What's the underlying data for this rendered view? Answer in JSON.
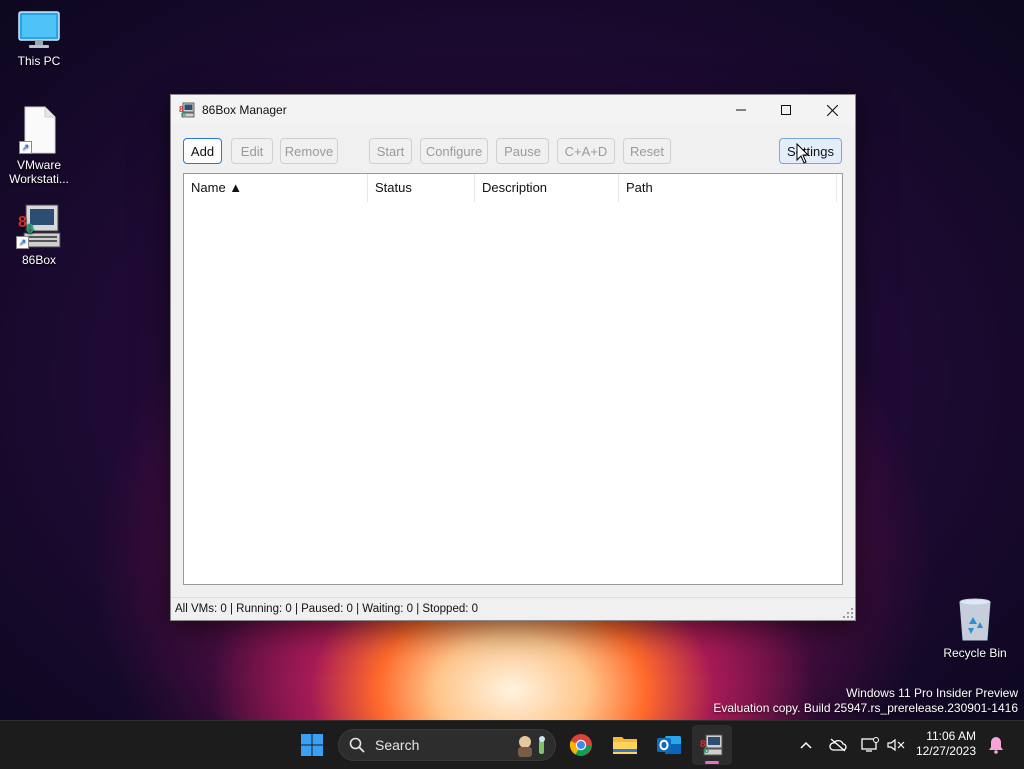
{
  "desktop": {
    "icons": [
      {
        "label": "This PC"
      },
      {
        "label": "VMware Workstati..."
      },
      {
        "label": "86Box"
      },
      {
        "label": "Recycle Bin"
      }
    ]
  },
  "window": {
    "title": "86Box Manager",
    "toolbar": {
      "add": "Add",
      "edit": "Edit",
      "remove": "Remove",
      "start": "Start",
      "configure": "Configure",
      "pause": "Pause",
      "cad": "C+A+D",
      "reset": "Reset",
      "settings": "Settings"
    },
    "columns": [
      "Name ▲",
      "Status",
      "Description",
      "Path"
    ],
    "rows": [],
    "status": "All VMs: 0 | Running: 0 | Paused: 0 | Waiting: 0 | Stopped: 0"
  },
  "watermark": {
    "line1": "Windows 11 Pro Insider Preview",
    "line2": "Evaluation copy. Build 25947.rs_prerelease.230901-1416"
  },
  "taskbar": {
    "search_placeholder": "Search",
    "time": "11:06 AM",
    "date": "12/27/2023",
    "apps": [
      "start-icon",
      "search-icon",
      "chrome-icon",
      "file-explorer-icon",
      "outlook-icon",
      "86box-icon"
    ]
  },
  "colors": {
    "accent": "#2b78d6",
    "taskbar": "#1c1c1c"
  }
}
